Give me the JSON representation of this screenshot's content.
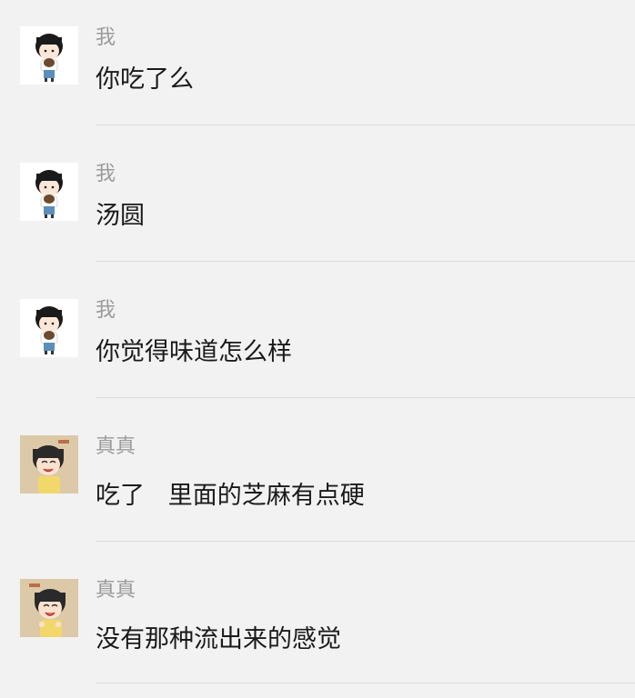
{
  "messages": [
    {
      "sender": "我",
      "text": "你吃了么",
      "avatar": "girl-avatar-icon"
    },
    {
      "sender": "我",
      "text": "汤圆",
      "avatar": "girl-avatar-icon"
    },
    {
      "sender": "我",
      "text": "你觉得味道怎么样",
      "avatar": "girl-avatar-icon"
    },
    {
      "sender": "真真",
      "text": "吃了   里面的芝麻有点硬",
      "avatar": "smiling-girl-avatar-icon"
    },
    {
      "sender": "真真",
      "text": "没有那种流出来的感觉",
      "avatar": "smiling-girl-avatar-icon"
    }
  ],
  "colors": {
    "background": "#f2f2f2",
    "sender": "#9b9b9b",
    "text": "#1a1a1a",
    "divider": "#dcdcdc",
    "avatar_bg_me": "#ffffff",
    "avatar_bg_other": "#dcc9a8"
  }
}
